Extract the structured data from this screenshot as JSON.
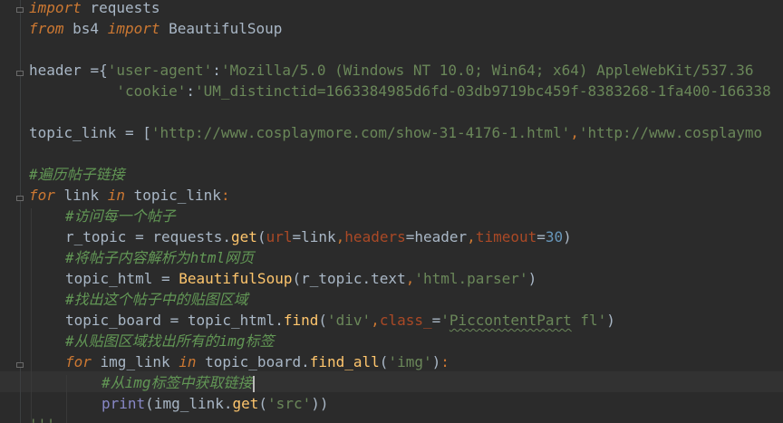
{
  "lines": {
    "l1": {
      "kw": "import",
      "rest": " requests"
    },
    "l2": {
      "kw1": "from",
      "mod": " bs4 ",
      "kw2": "import",
      "rest": " BeautifulSoup"
    },
    "l4": {
      "name": "header ",
      "eq": "={",
      "k1": "'user-agent'",
      "colon": ":",
      "v1": "'Mozilla/5.0 (Windows NT 10.0; Win64; x64) AppleWebKit/537.36"
    },
    "l5": {
      "pad": "          ",
      "k2": "'cookie'",
      "colon": ":",
      "v2": "'UM_distinctid=1663384985d6fd-03db9719bc459f-8383268-1fa400-166338"
    },
    "l7": {
      "name": "topic_link = [",
      "v1": "'http://www.cosplaymore.com/show-31-4176-1.html'",
      "comma": ",",
      "v2": "'http://www.cosplaymo"
    },
    "l9": {
      "comment": "#遍历帖子链接"
    },
    "l10": {
      "kw1": "for",
      "a": " link ",
      "kw2": "in",
      "b": " topic_link",
      "colon": ":"
    },
    "l11": {
      "comment": "#访问每一个帖子"
    },
    "l12": {
      "a": "r_topic = requests.",
      "fn": "get",
      "p1": "(",
      "k1": "url",
      "e1": "=link",
      "c1": ",",
      "k2": "headers",
      "e2": "=header",
      "c2": ",",
      "k3": "timeout",
      "e3": "=",
      "num": "30",
      "close": ")"
    },
    "l13": {
      "comment": "#将帖子内容解析为html网页"
    },
    "l14": {
      "a": "topic_html = ",
      "fn": "BeautifulSoup",
      "b": "(r_topic.text",
      "c": ",",
      "s": "'html.parser'",
      "close": ")"
    },
    "l15": {
      "comment": "#找出这个帖子中的贴图区域"
    },
    "l16": {
      "a": "topic_board = topic_html.",
      "fn": "find",
      "b": "(",
      "s1": "'div'",
      "c": ",",
      "k": "class_",
      "eq": "=",
      "s2a": "'",
      "s2b": "PiccontentPart",
      "s2c": " fl'",
      "close": ")"
    },
    "l17": {
      "comment": "#从贴图区域找出所有的img标签"
    },
    "l18": {
      "kw1": "for",
      "a": " img_link ",
      "kw2": "in",
      "b": " topic_board.",
      "fn": "find_all",
      "c": "(",
      "s": "'img'",
      "close": ")",
      "colon": ":"
    },
    "l19": {
      "comment": "#从img标签中获取链接"
    },
    "l20": {
      "bi": "print",
      "a": "(img_link.",
      "fn": "get",
      "b": "(",
      "s": "'src'",
      "close": "))"
    },
    "l21": {
      "text": "'''"
    }
  }
}
